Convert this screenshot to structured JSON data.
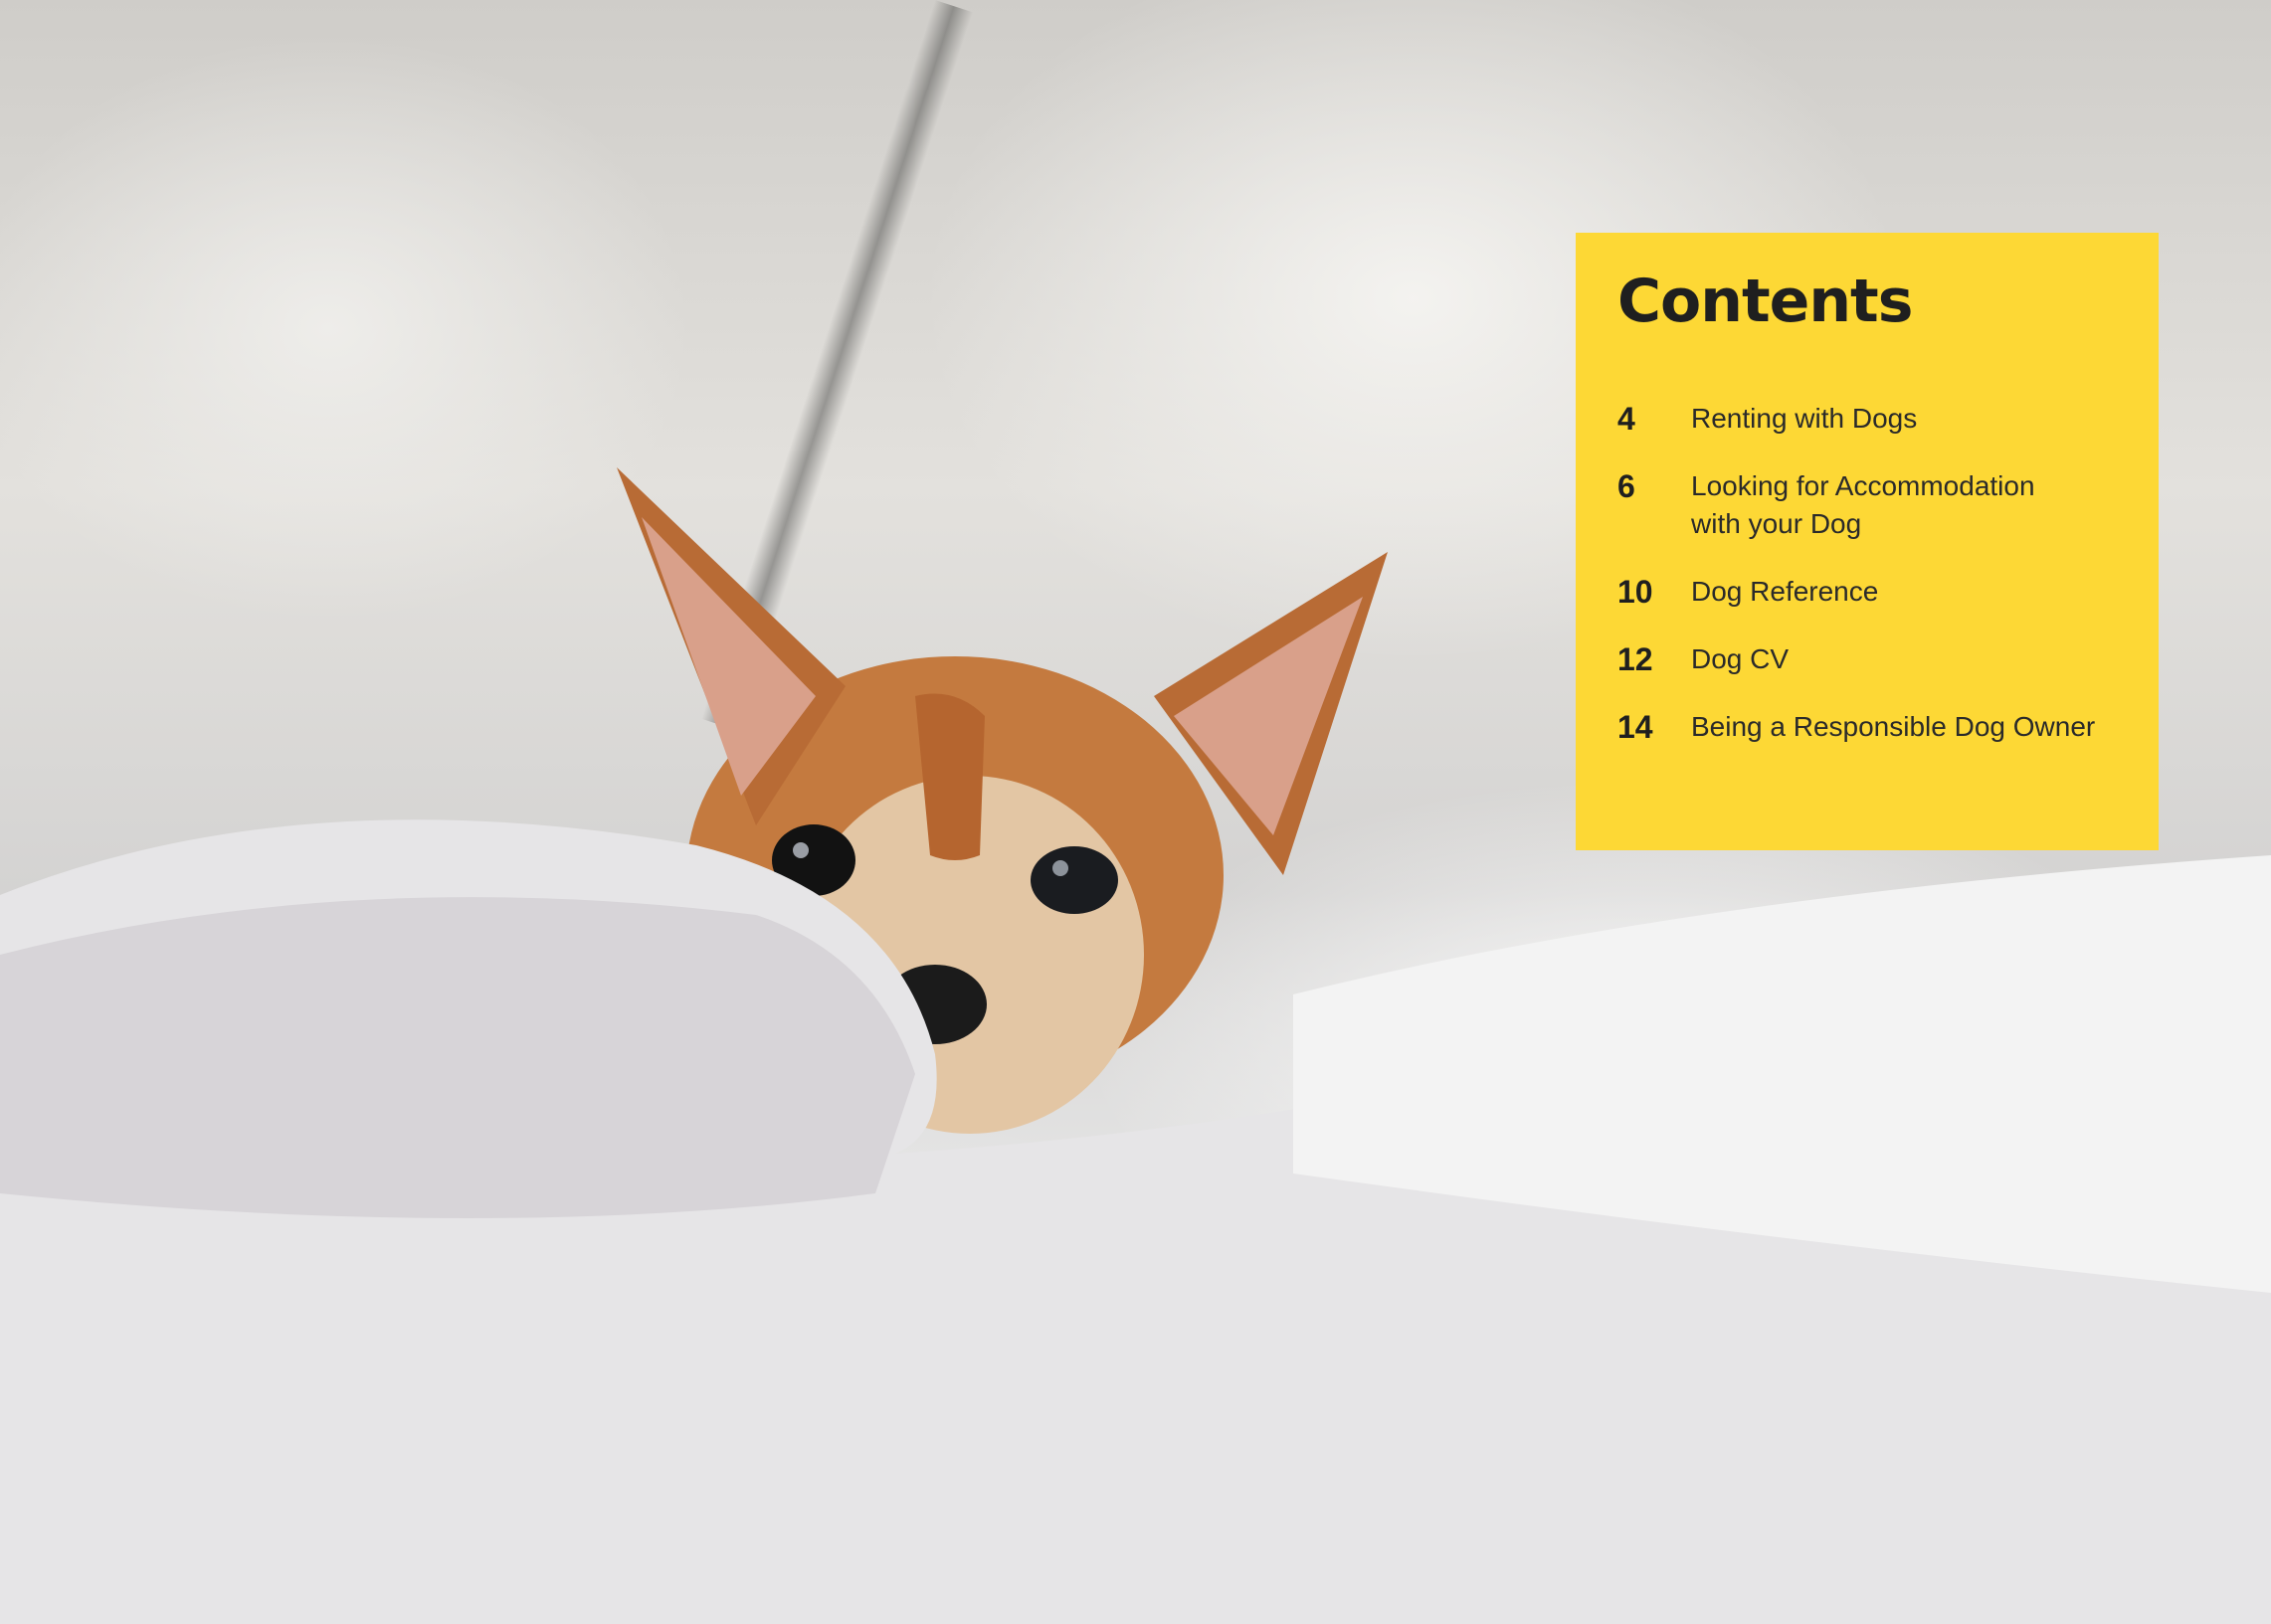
{
  "photo": {
    "subject-icon": "dog-under-blanket-photo"
  },
  "contents": {
    "title": "Contents",
    "items": [
      {
        "page": "4",
        "label": "Renting with Dogs"
      },
      {
        "page": "6",
        "label": "Looking for Accommodation with your Dog"
      },
      {
        "page": "10",
        "label": "Dog Reference"
      },
      {
        "page": "12",
        "label": "Dog CV"
      },
      {
        "page": "14",
        "label": "Being a Responsible Dog Owner"
      }
    ],
    "background_color": "#fdd835"
  }
}
